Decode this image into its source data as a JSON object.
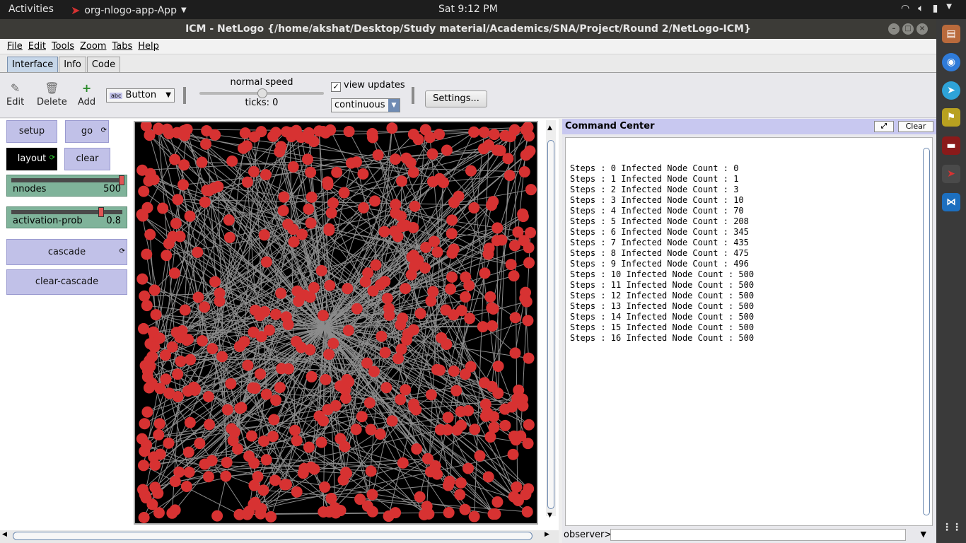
{
  "topbar": {
    "activities": "Activities",
    "app": "org-nlogo-app-App",
    "clock": "Sat  9:12 PM"
  },
  "window": {
    "title": "ICM - NetLogo {/home/akshat/Desktop/Study material/Academics/SNA/Project/Round 2/NetLogo-ICM}"
  },
  "menu": [
    "File",
    "Edit",
    "Tools",
    "Zoom",
    "Tabs",
    "Help"
  ],
  "tabs": [
    "Interface",
    "Info",
    "Code"
  ],
  "toolbar": {
    "edit": "Edit",
    "delete": "Delete",
    "add": "Add",
    "widget_type": "Button",
    "speed_label": "normal speed",
    "ticks": "ticks: 0",
    "view_updates": "view updates",
    "update_mode": "continuous",
    "settings": "Settings..."
  },
  "widgets": {
    "setup": "setup",
    "go": "go",
    "layout": "layout",
    "clear": "clear",
    "nnodes_name": "nnodes",
    "nnodes_value": "500",
    "activation_name": "activation-prob",
    "activation_value": "0.8",
    "cascade": "cascade",
    "clear_cascade": "clear-cascade"
  },
  "command_center": {
    "title": "Command Center",
    "clear": "Clear",
    "prompt": "observer>",
    "lines": [
      "Steps : 0 Infected Node Count : 0",
      "Steps : 1 Infected Node Count : 1",
      "Steps : 2 Infected Node Count : 3",
      "Steps : 3 Infected Node Count : 10",
      "Steps : 4 Infected Node Count : 70",
      "Steps : 5 Infected Node Count : 208",
      "Steps : 6 Infected Node Count : 345",
      "Steps : 7 Infected Node Count : 435",
      "Steps : 8 Infected Node Count : 475",
      "Steps : 9 Infected Node Count : 496",
      "Steps : 10 Infected Node Count : 500",
      "Steps : 11 Infected Node Count : 500",
      "Steps : 12 Infected Node Count : 500",
      "Steps : 13 Infected Node Count : 500",
      "Steps : 14 Infected Node Count : 500",
      "Steps : 15 Infected Node Count : 500",
      "Steps : 16 Infected Node Count : 500"
    ]
  },
  "colors": {
    "node": "#d73232",
    "link": "#8c8c8c",
    "button": "#c1c1e8",
    "slider": "#7fb39a"
  }
}
